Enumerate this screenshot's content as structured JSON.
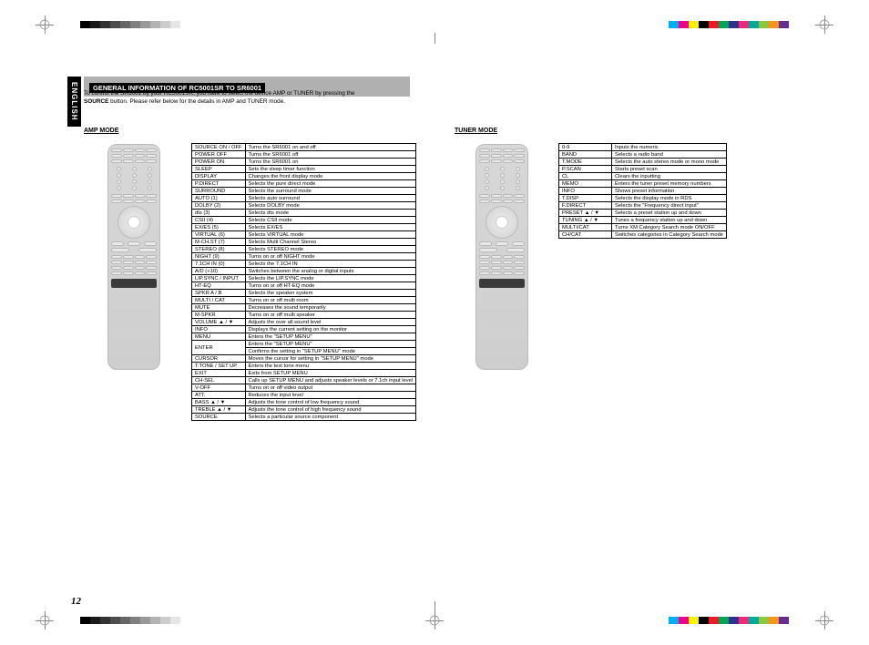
{
  "swatches_gray": [
    "#000000",
    "#1a1a1a",
    "#333333",
    "#4d4d4d",
    "#666666",
    "#808080",
    "#999999",
    "#b3b3b3",
    "#cccccc",
    "#e6e6e6",
    "#ffffff"
  ],
  "swatches_color": [
    "#00aeef",
    "#ec008c",
    "#fff200",
    "#000000",
    "#ed1c24",
    "#00a651",
    "#2e3192",
    "#ee2a7b",
    "#00a99d",
    "#8dc63f",
    "#f7941d",
    "#662d91"
  ],
  "lang_tab": "ENGLISH",
  "header": "GENERAL INFORMATION OF RC5001SR TO SR6001",
  "intro_line1": "To control the SR6001 by your RC5001SR, you have to select the device AMP or TUNER by pressing the",
  "intro_line2_bold": "SOURCE",
  "intro_line2_rest": " button. Please refer below for the details in AMP and TUNER mode.",
  "amp_mode_label": "AMP MODE",
  "tuner_mode_label": "TUNER MODE",
  "page_number": "12",
  "amp_table": [
    [
      "SOURCE ON / OFF",
      "Turns the SR6001 on and off"
    ],
    [
      "POWER OFF",
      "Turns the SR6001 off"
    ],
    [
      "POWER ON",
      "Turns the SR6001 on"
    ],
    [
      "SLEEP",
      "Sets the sleep timer function"
    ],
    [
      "DISPLAY",
      "Changes the front display mode"
    ],
    [
      "P.DIRECT",
      "Selects the pure direct mode"
    ],
    [
      "SURROUND",
      "Selects the surround mode"
    ],
    [
      "AUTO (1)",
      "Selects auto surround"
    ],
    [
      "DOLBY (2)",
      "Selects DOLBY mode"
    ],
    [
      "dts (3)",
      "Selects dts mode"
    ],
    [
      "CSII (4)",
      "Selects CSII mode"
    ],
    [
      "EX/ES (5)",
      "Selects EX/ES"
    ],
    [
      "VIRTUAL (6)",
      "Selects VIRTUAL mode"
    ],
    [
      "M-CH.ST (7)",
      "Selects Multi Channel Stereo"
    ],
    [
      "STEREO (8)",
      "Selects STEREO mode"
    ],
    [
      "NIGHT (9)",
      "Turns on or off NIGHT mode"
    ],
    [
      "7.1CH IN (0)",
      "Selects the 7.1CH IN"
    ],
    [
      "A/D (+10)",
      "Switches between the analog or digital inputs"
    ],
    [
      "LIP.SYNC / INPUT",
      "Selects the LIP.SYNC mode"
    ],
    [
      "HT-EQ",
      "Turns on or off HT-EQ mode"
    ],
    [
      "SPKR A / B",
      "Selects the speaker system"
    ],
    [
      "MULTI / CAT",
      "Turns on or off multi room"
    ],
    [
      "MUTE",
      "Decreases the sound temporarily"
    ],
    [
      "M-SPKR",
      "Turns on or off multi speaker"
    ],
    [
      "VOLUME ▲ / ▼",
      "Adjusts the over all sound level"
    ],
    [
      "INFO",
      "Displays the current setting on the monitor"
    ],
    [
      "MENU",
      "Enters the \"SETUP MENU\""
    ],
    [
      "ENTER",
      "Enters the \"SETUP MENU\""
    ],
    [
      "",
      "Confirms the setting in \"SETUP MENU\" mode"
    ],
    [
      "CURSOR",
      "Moves the cursor for setting in \"SETUP MENU\" mode"
    ],
    [
      "T.TONE / SET UP",
      "Enters the test tone menu"
    ],
    [
      "EXIT",
      "Exits from SETUP MENU"
    ],
    [
      "CH-SEL",
      "Calls up SETUP MENU and adjusts speaker levels or 7.1ch input level"
    ],
    [
      "V-OFF",
      "Turns on or off video output"
    ],
    [
      "ATT.",
      "Reduces the input level"
    ],
    [
      "BASS ▲ / ▼",
      "Adjusts the tone control of low frequency sound"
    ],
    [
      "TREBLE ▲ / ▼",
      "Adjusts the tone control of high frequency sound"
    ],
    [
      "SOURCE",
      "Selects a particular source component"
    ]
  ],
  "tuner_table": [
    [
      "0-9",
      "Inputs the numeric"
    ],
    [
      "BAND",
      "Selects a radio band"
    ],
    [
      "T.MODE",
      "Selects the auto stereo mode or mono mode"
    ],
    [
      "P.SCAN",
      "Starts preset scan"
    ],
    [
      "CL",
      "Clears the inputting"
    ],
    [
      "MEMO",
      "Enters the tuner preset memory numbers"
    ],
    [
      "INFO",
      "Shows preset information"
    ],
    [
      "T.DISP",
      "Selects the display mode in RDS"
    ],
    [
      "F.DIRECT",
      "Selects the \"Frequency direct input\""
    ],
    [
      "PRESET ▲ / ▼",
      "Selects a preset station up and down"
    ],
    [
      "TUNING ▲ / ▼",
      "Tunes a frequency station up and down"
    ],
    [
      "MULTI/CAT",
      "Turns XM Category Search mode ON/OFF"
    ],
    [
      "CH/CAT",
      "Switches categories in Category Search mode"
    ]
  ]
}
